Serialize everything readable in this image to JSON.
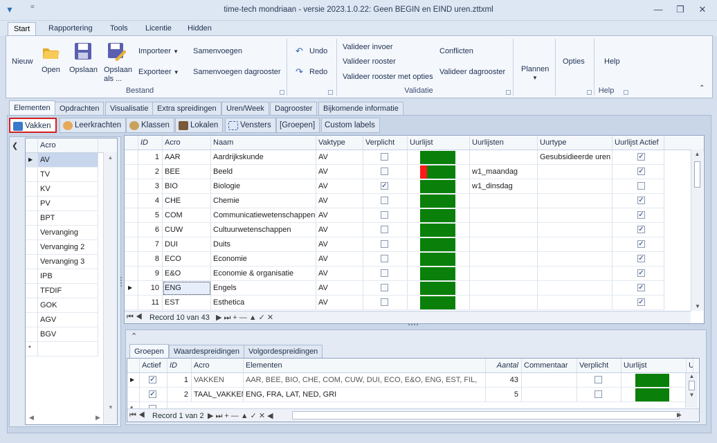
{
  "window": {
    "title": "time-tech mondriaan - versie 2023.1.0.22: Geen BEGIN en EIND uren.zttxml",
    "qat_icon": "chevron-down-icon",
    "qat_extra": "="
  },
  "ribbon_tabs": [
    "Start",
    "Rapportering",
    "Tools",
    "Licentie",
    "Hidden"
  ],
  "ribbon": {
    "nieuw": "Nieuw",
    "open": "Open",
    "opslaan": "Opslaan",
    "opslaan_als": "Opslaan als ...",
    "importeer": "Importeer",
    "exporteer": "Exporteer",
    "samenvoegen": "Samenvoegen",
    "samenvoegen_dag": "Samenvoegen dagrooster",
    "bestand": "Bestand",
    "undo": "Undo",
    "redo": "Redo",
    "val_invoer": "Valideer invoer",
    "val_rooster": "Valideer rooster",
    "val_opties": "Valideer rooster met opties",
    "conflicten": "Conflicten",
    "val_dag": "Valideer dagrooster",
    "validatie": "Validatie",
    "plannen": "Plannen",
    "opties": "Opties",
    "help": "Help",
    "help_group": "Help"
  },
  "main_tabs": [
    "Elementen",
    "Opdrachten",
    "Visualisatie",
    "Extra spreidingen",
    "Uren/Week",
    "Dagrooster",
    "Bijkomende informatie"
  ],
  "sub_tabs": [
    "Vakken",
    "Leerkrachten",
    "Klassen",
    "Lokalen",
    "Vensters",
    "[Groepen]",
    "Custom labels"
  ],
  "left_list": {
    "header": "Acro",
    "items": [
      "AV",
      "TV",
      "KV",
      "PV",
      "BPT",
      "Vervanging",
      "Vervanging 2",
      "Vervanging 3",
      "IPB",
      "TFDIF",
      "GOK",
      "AGV",
      "BGV"
    ],
    "new_row": "*"
  },
  "vakken": {
    "headers": [
      "ID",
      "Acro",
      "Naam",
      "Vaktype",
      "Verplicht",
      "Uurlijst",
      "Uurlijsten",
      "Uurtype",
      "Uurlijst Actief"
    ],
    "rows": [
      {
        "id": "1",
        "acro": "AAR",
        "naam": "Aardrijkskunde",
        "vaktype": "AV",
        "verplicht": false,
        "red": 0,
        "uurlijsten": "",
        "uurtype": "Gesubsidieerde uren",
        "actief": true
      },
      {
        "id": "2",
        "acro": "BEE",
        "naam": "Beeld",
        "vaktype": "AV",
        "verplicht": false,
        "red": 1,
        "uurlijsten": "w1_maandag",
        "uurtype": "",
        "actief": true
      },
      {
        "id": "3",
        "acro": "BIO",
        "naam": "Biologie",
        "vaktype": "AV",
        "verplicht": true,
        "red": 0,
        "uurlijsten": "w1_dinsdag",
        "uurtype": "",
        "actief": false
      },
      {
        "id": "4",
        "acro": "CHE",
        "naam": "Chemie",
        "vaktype": "AV",
        "verplicht": false,
        "red": 0,
        "uurlijsten": "",
        "uurtype": "",
        "actief": true
      },
      {
        "id": "5",
        "acro": "COM",
        "naam": "Communicatiewetenschappen",
        "vaktype": "AV",
        "verplicht": false,
        "red": 0,
        "uurlijsten": "",
        "uurtype": "",
        "actief": true
      },
      {
        "id": "6",
        "acro": "CUW",
        "naam": "Cultuurwetenschappen",
        "vaktype": "AV",
        "verplicht": false,
        "red": 0,
        "uurlijsten": "",
        "uurtype": "",
        "actief": true
      },
      {
        "id": "7",
        "acro": "DUI",
        "naam": "Duits",
        "vaktype": "AV",
        "verplicht": false,
        "red": 0,
        "uurlijsten": "",
        "uurtype": "",
        "actief": true
      },
      {
        "id": "8",
        "acro": "ECO",
        "naam": "Economie",
        "vaktype": "AV",
        "verplicht": false,
        "red": 0,
        "uurlijsten": "",
        "uurtype": "",
        "actief": true
      },
      {
        "id": "9",
        "acro": "E&O",
        "naam": "Economie & organisatie",
        "vaktype": "AV",
        "verplicht": false,
        "red": 0,
        "uurlijsten": "",
        "uurtype": "",
        "actief": true
      },
      {
        "id": "10",
        "acro": "ENG",
        "naam": "Engels",
        "vaktype": "AV",
        "verplicht": false,
        "red": 0,
        "uurlijsten": "",
        "uurtype": "",
        "actief": true
      },
      {
        "id": "11",
        "acro": "EST",
        "naam": "Esthetica",
        "vaktype": "AV",
        "verplicht": false,
        "red": 0,
        "uurlijsten": "",
        "uurtype": "",
        "actief": true
      }
    ],
    "record": "Record 10 van 43"
  },
  "bottom_tabs": [
    "Groepen",
    "Waardespreidingen",
    "Volgordespreidingen"
  ],
  "groepen": {
    "headers": [
      "Actief",
      "ID",
      "Acro",
      "Elementen",
      "Aantal",
      "Commentaar",
      "Verplicht",
      "Uurlijst",
      "U"
    ],
    "rows": [
      {
        "actief": true,
        "id": "1",
        "acro": "VAKKEN",
        "elementen": "AAR, BEE, BIO, CHE, COM, CUW, DUI, ECO, E&O, ENG, EST, FIL,",
        "aantal": "43",
        "commentaar": "",
        "verplicht": false
      },
      {
        "actief": true,
        "id": "2",
        "acro": "TAAL_VAKKEN",
        "elementen": "ENG, FRA, LAT, NED, GRI",
        "aantal": "5",
        "commentaar": "",
        "verplicht": false
      }
    ],
    "record": "Record 1 van 2"
  },
  "colors": {
    "green": "#0a800a",
    "red": "#ff1a1a",
    "highlight": "#d42020"
  }
}
